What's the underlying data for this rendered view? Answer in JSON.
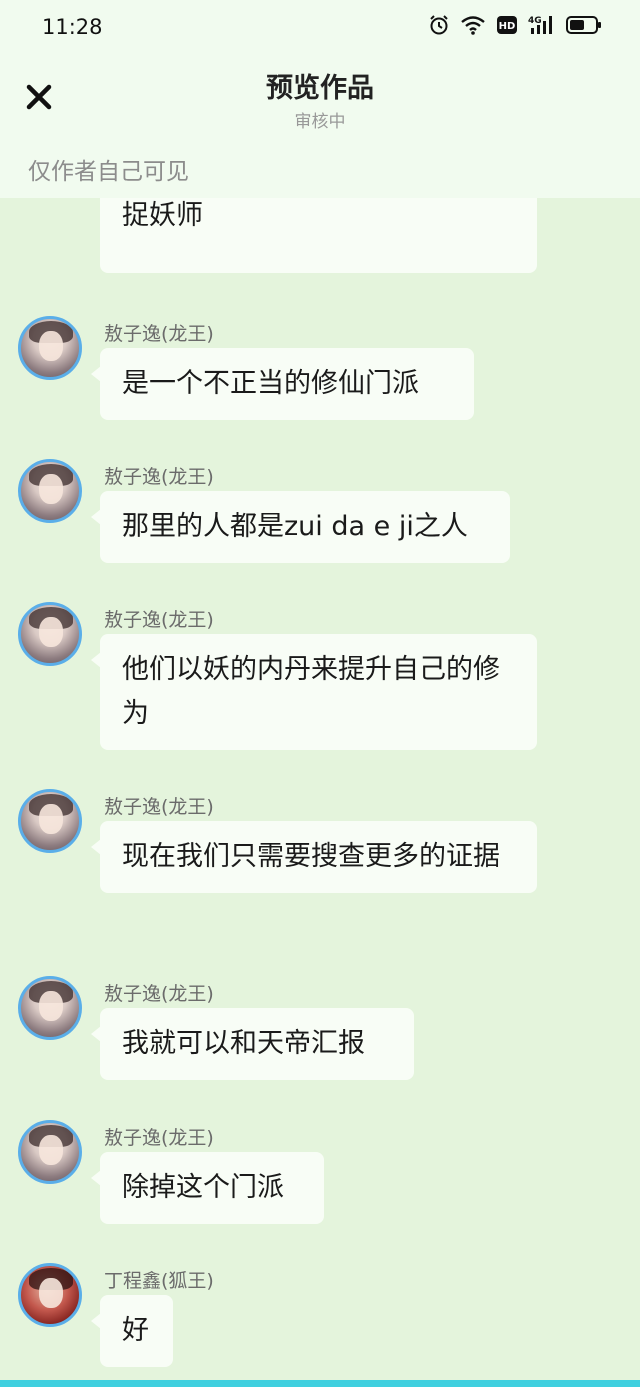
{
  "status_bar": {
    "time": "11:28",
    "icons": [
      "alarm-icon",
      "wifi-icon",
      "hd-icon",
      "signal-4g-icon",
      "battery-icon"
    ]
  },
  "header": {
    "title": "预览作品",
    "subtitle": "审核中",
    "close_icon": "close-icon"
  },
  "notice": "仅作者自己可见",
  "messages": [
    {
      "text": "当年zhui sha:狼族和松鼠一族的捉妖师"
    },
    {
      "sender": "敖子逸(龙王)",
      "text": "是一个不正当的修仙门派"
    },
    {
      "sender": "敖子逸(龙王)",
      "text": "那里的人都是zui da e ji之人"
    },
    {
      "sender": "敖子逸(龙王)",
      "text": "他们以妖的内丹来提升自己的修为"
    },
    {
      "sender": "敖子逸(龙王)",
      "text": "现在我们只需要搜查更多的证据"
    },
    {
      "sender": "敖子逸(龙王)",
      "text": "我就可以和天帝汇报"
    },
    {
      "sender": "敖子逸(龙王)",
      "text": "除掉这个门派"
    },
    {
      "sender": "丁程鑫(狐王)",
      "text": "好"
    }
  ],
  "colors": {
    "background": "#e4f4dc",
    "bubble": "#f8fdf6",
    "avatar_ring": "#5aaee9",
    "bottom_bar": "#3fd0df"
  }
}
